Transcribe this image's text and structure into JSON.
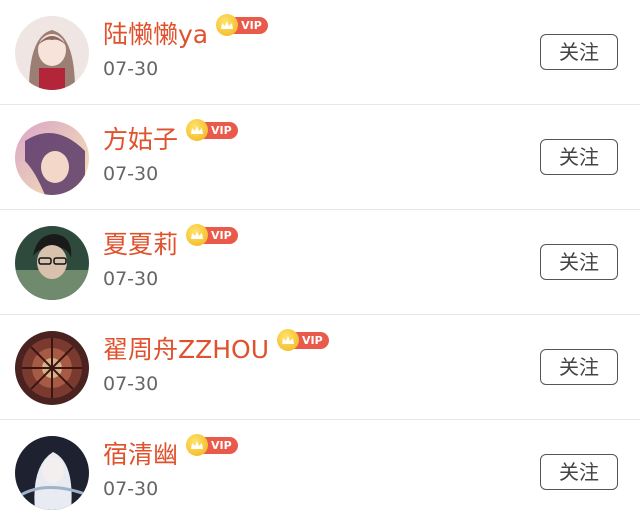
{
  "follow_list": {
    "items": [
      {
        "name": "陆懒懒ya",
        "date": "07-30",
        "badge": "VIP",
        "button": "关注",
        "avatar": "avatar-anime-girl"
      },
      {
        "name": "方姑子",
        "date": "07-30",
        "badge": "VIP",
        "button": "关注",
        "avatar": "avatar-purple-girl"
      },
      {
        "name": "夏夏莉",
        "date": "07-30",
        "badge": "VIP",
        "button": "关注",
        "avatar": "avatar-boy-green"
      },
      {
        "name": "翟周舟ZZHOU",
        "date": "07-30",
        "badge": "VIP",
        "button": "关注",
        "avatar": "avatar-dark-art"
      },
      {
        "name": "宿清幽",
        "date": "07-30",
        "badge": "VIP",
        "button": "关注",
        "avatar": "avatar-white-hair"
      }
    ]
  },
  "colors": {
    "name": "#e0522d",
    "date": "#666666",
    "vip_pill": "#e95a4a",
    "vip_crown": "#f2b21b",
    "divider": "#e6e6e6"
  }
}
